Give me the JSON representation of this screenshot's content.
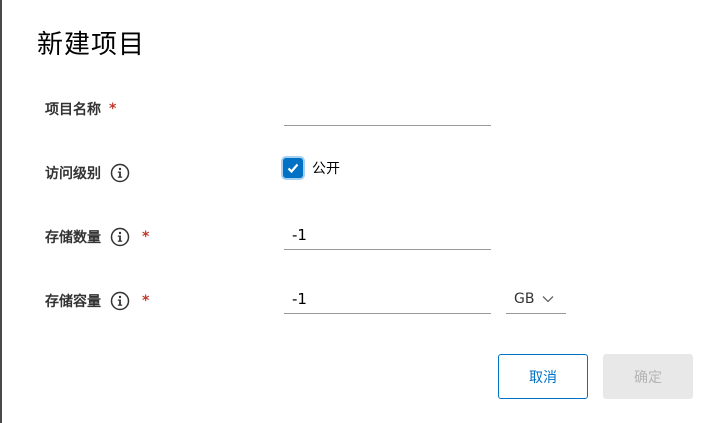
{
  "dialog": {
    "title": "新建项目",
    "fields": {
      "name": {
        "label": "项目名称",
        "required_mark": "*",
        "value": ""
      },
      "access": {
        "label": "访问级别",
        "checkbox_label": "公开",
        "checked": true
      },
      "storage_count": {
        "label": "存储数量",
        "required_mark": "*",
        "value": "-1"
      },
      "storage_capacity": {
        "label": "存储容量",
        "required_mark": "*",
        "value": "-1",
        "unit": "GB"
      }
    },
    "buttons": {
      "cancel": "取消",
      "confirm": "确定"
    }
  },
  "colors": {
    "accent": "#0072c6",
    "required": "#c0392b",
    "disabled_bg": "#e8e8e8",
    "disabled_text": "#b5b5b5"
  },
  "icons": {
    "info": "info-circle-icon",
    "check": "checkmark-icon",
    "dropdown": "chevron-down-icon"
  }
}
